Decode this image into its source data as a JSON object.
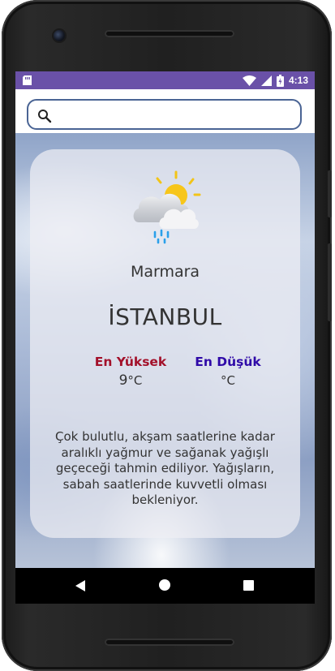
{
  "status_bar": {
    "time": "4:13",
    "icons": [
      "sd-card-icon",
      "wifi-icon",
      "signal-icon",
      "battery-icon"
    ]
  },
  "search": {
    "placeholder": "",
    "value": ""
  },
  "weather": {
    "icon": "partly-cloudy-rain-icon",
    "region": "Marmara",
    "city": "İSTANBUL",
    "high_label": "En Yüksek",
    "high_value": "9",
    "high_unit": "°C",
    "low_label": "En Düşük",
    "low_value": "",
    "low_unit": "°C",
    "description": "Çok bulutlu, akşam saatlerine kadar aralıklı yağmur ve sağanak yağışlı geçeceği tahmin ediliyor. Yağışların, sabah saatlerinde kuvvetli olması bekleniyor.",
    "colors": {
      "high": "#a3102a",
      "low": "#2f0aa8",
      "status_bar": "#6a51a8",
      "search_border": "#4a6494"
    }
  },
  "nav": {
    "buttons": [
      "back-icon",
      "home-icon",
      "recents-icon"
    ]
  }
}
